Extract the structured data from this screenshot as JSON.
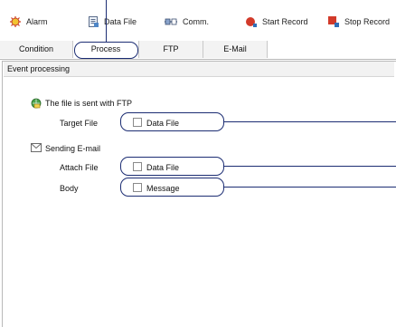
{
  "toolbar": {
    "alarm": "Alarm",
    "data_file": "Data File",
    "comm": "Comm.",
    "start_record": "Start Record",
    "stop_record": "Stop Record"
  },
  "tabs": [
    "Condition",
    "Process",
    "FTP",
    "E-Mail"
  ],
  "active_tab": "Process",
  "section": {
    "title": "Event processing"
  },
  "ftp": {
    "heading": "The file is sent with FTP",
    "target_label": "Target File",
    "target_value": "Data File"
  },
  "email": {
    "heading": "Sending E-mail",
    "attach_label": "Attach File",
    "attach_value": "Data File",
    "body_label": "Body",
    "body_value": "Message"
  },
  "icons": [
    "alarm-icon",
    "data-file-icon",
    "comm-icon",
    "start-record-icon",
    "stop-record-icon",
    "ftp-icon",
    "email-icon"
  ]
}
